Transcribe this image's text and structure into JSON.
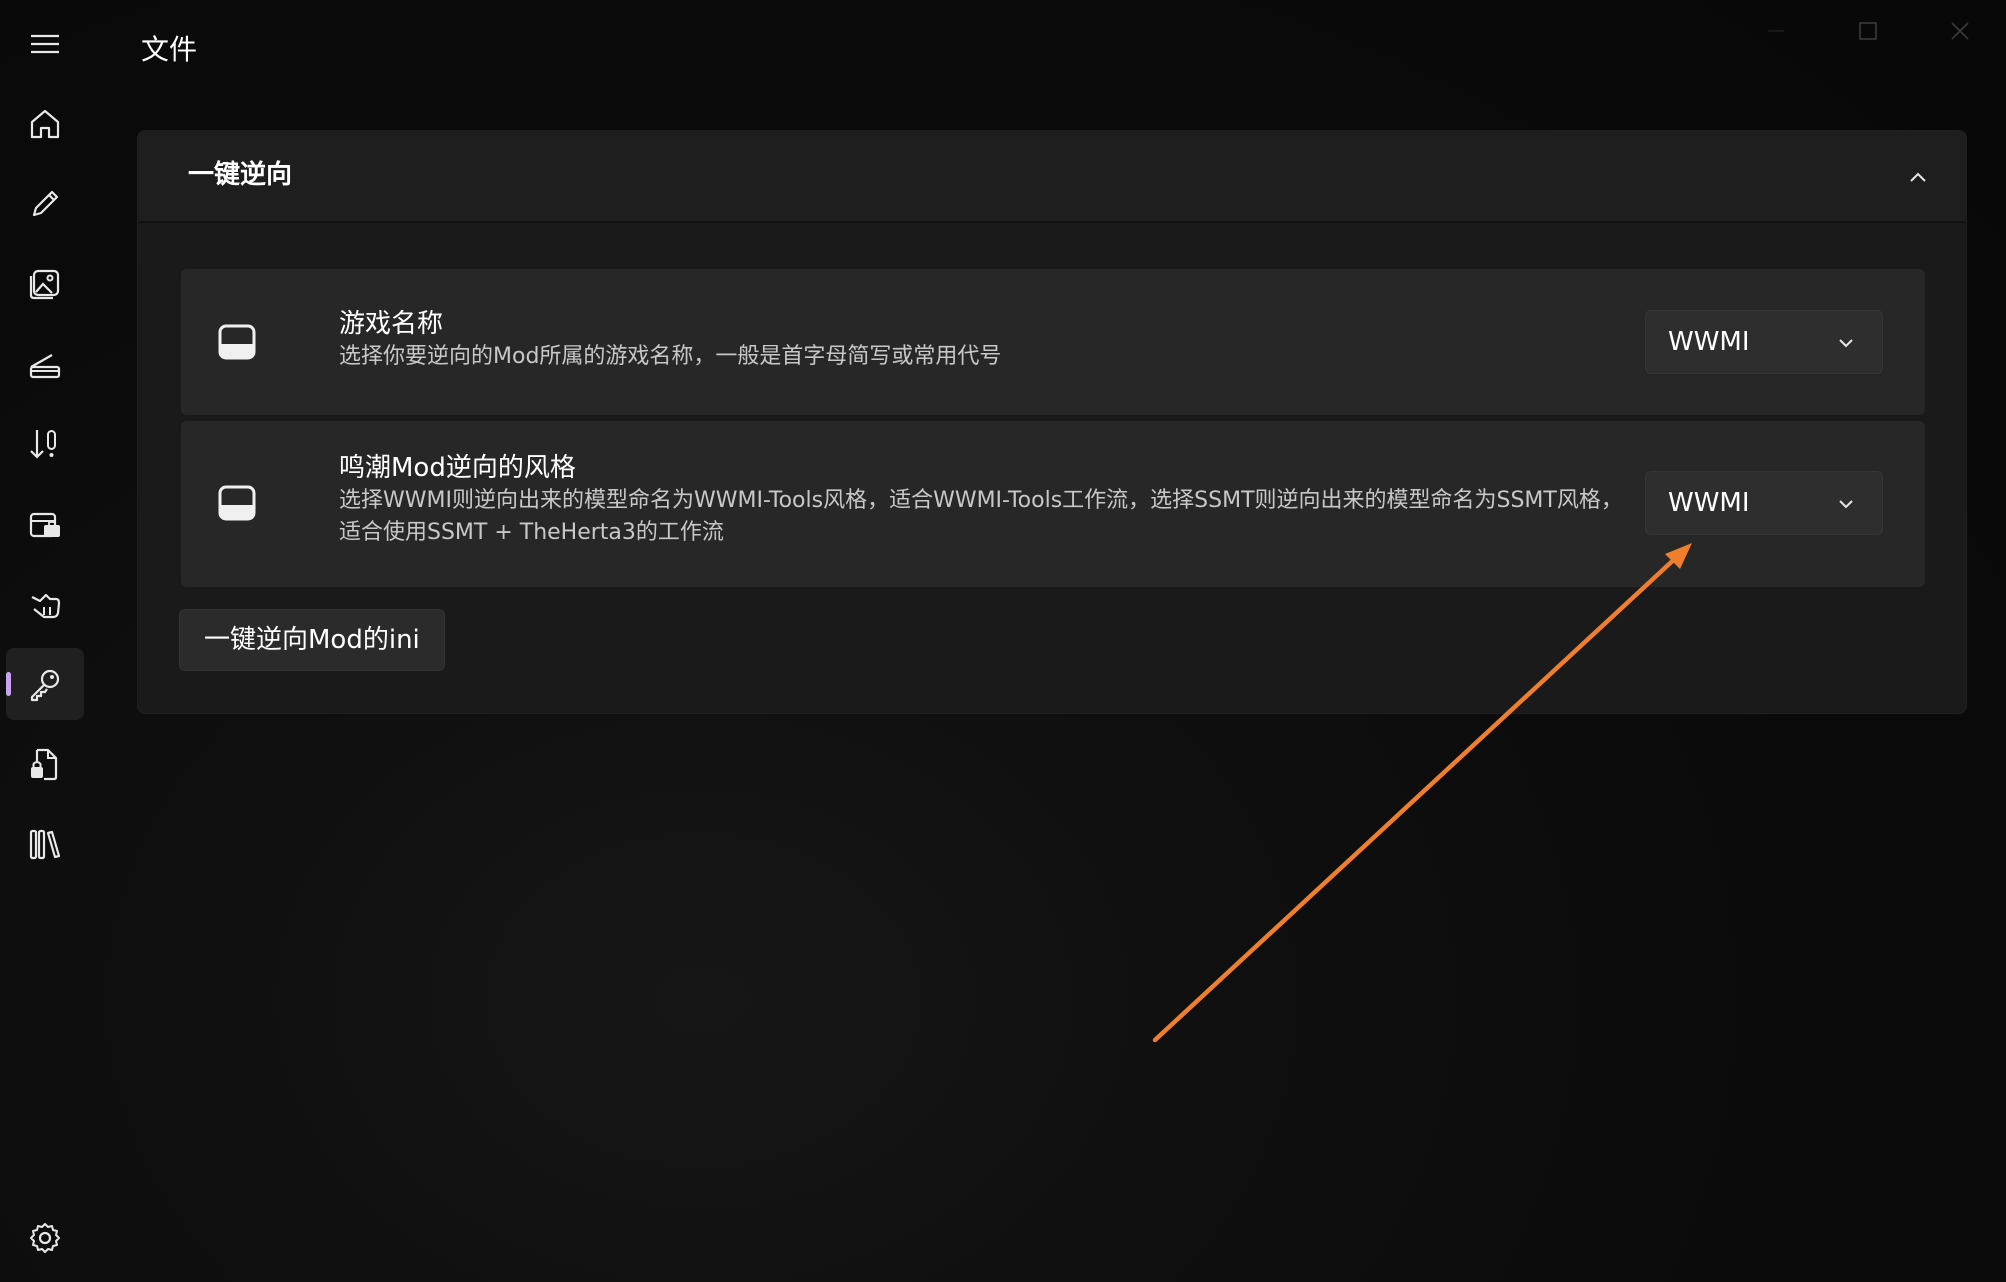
{
  "window": {
    "title": "文件",
    "caption_buttons": [
      "minimize-icon",
      "maximize-icon",
      "close-icon"
    ]
  },
  "sidebar": {
    "menu_icon": "hamburger-menu-icon",
    "items": [
      {
        "icon": "home-icon"
      },
      {
        "icon": "pencil-icon"
      },
      {
        "icon": "image-icon"
      },
      {
        "icon": "scanner-icon"
      },
      {
        "icon": "sort-down-icon"
      },
      {
        "icon": "toolbox-icon"
      },
      {
        "icon": "cursor-hand-icon"
      },
      {
        "icon": "key-icon",
        "selected": true
      },
      {
        "icon": "file-lock-icon"
      },
      {
        "icon": "library-icon"
      }
    ],
    "settings_icon": "gear-icon",
    "accent_color": "#c9a3f0"
  },
  "expander": {
    "title": "一键逆向",
    "expanded": true,
    "cards": [
      {
        "title": "游戏名称",
        "description": "选择你要逆向的Mod所属的游戏名称，一般是首字母简写或常用代号",
        "combo_value": "WWMI"
      },
      {
        "title": "鸣潮Mod逆向的风格",
        "description": "选择WWMI则逆向出来的模型命名为WWMI-Tools风格，适合WWMI-Tools工作流，选择SSMT则逆向出来的模型命名为SSMT风格，适合使用SSMT + TheHerta3的工作流",
        "combo_value": "WWMI"
      }
    ],
    "action_label": "一键逆向Mod的ini"
  },
  "annotation": {
    "type": "arrow",
    "color": "#f07f2d"
  }
}
